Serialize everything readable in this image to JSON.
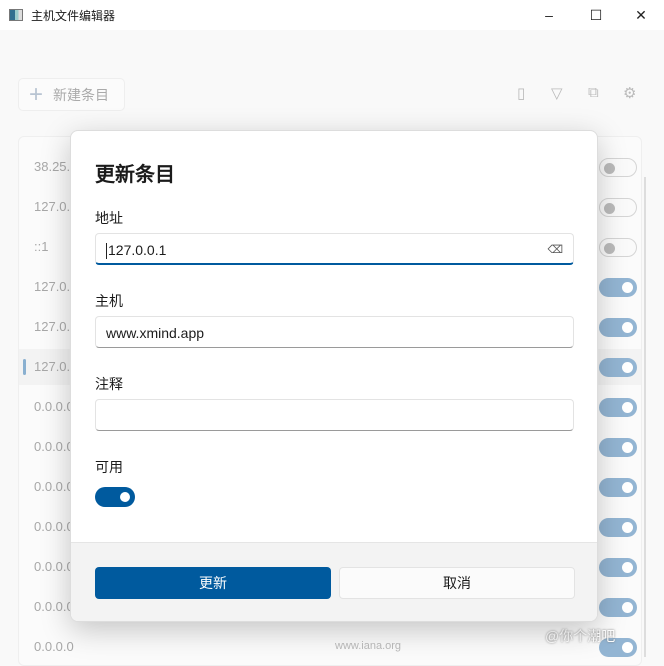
{
  "window": {
    "title": "主机文件编辑器",
    "minimize": "–",
    "maximize": "☐",
    "close": "✕"
  },
  "toolbar": {
    "new_entry": "新建条目",
    "plus": "+"
  },
  "entries": [
    {
      "address": "38.25.",
      "enabled": false
    },
    {
      "address": "127.0.",
      "enabled": false
    },
    {
      "address": "::1",
      "enabled": false
    },
    {
      "address": "127.0.",
      "enabled": true
    },
    {
      "address": "127.0.",
      "enabled": true
    },
    {
      "address": "127.0.",
      "enabled": true,
      "selected": true
    },
    {
      "address": "0.0.0.0",
      "enabled": true
    },
    {
      "address": "0.0.0.0",
      "enabled": true
    },
    {
      "address": "0.0.0.0",
      "enabled": true
    },
    {
      "address": "0.0.0.0",
      "enabled": true
    },
    {
      "address": "0.0.0.0",
      "enabled": true
    },
    {
      "address": "0.0.0.0",
      "enabled": true
    },
    {
      "address": "0.0.0.0",
      "enabled": true
    }
  ],
  "list_footer_text": "www.iana.org",
  "watermark": "@你个潮吧",
  "dialog": {
    "title": "更新条目",
    "address_label": "地址",
    "address_value": "127.0.0.1",
    "host_label": "主机",
    "host_value": "www.xmind.app",
    "comment_label": "注释",
    "comment_value": "",
    "enabled_label": "可用",
    "enabled": true,
    "update_button": "更新",
    "cancel_button": "取消"
  }
}
